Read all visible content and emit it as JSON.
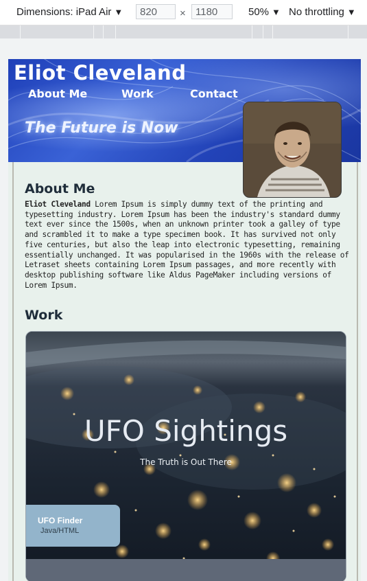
{
  "devtools": {
    "dimensions_label": "Dimensions: iPad Air",
    "width_value": "820",
    "times_symbol": "×",
    "height_value": "1180",
    "zoom": "50%",
    "throttling": "No throttling",
    "caret": "▼"
  },
  "site": {
    "title": "Eliot Cleveland",
    "nav": [
      "About Me",
      "Work",
      "Contact"
    ],
    "tagline": "The Future is Now"
  },
  "about": {
    "heading": "About Me",
    "name": "Eliot Cleveland",
    "body": " Lorem Ipsum is simply dummy text of the printing and typesetting industry. Lorem Ipsum has been the industry's standard dummy text ever since the 1500s, when an unknown printer took a galley of type and scrambled it to make a type specimen book. It has survived not only five centuries, but also the leap into electronic typesetting, remaining essentially unchanged. It was popularised in the 1960s with the release of Letraset sheets containing Lorem Ipsum passages, and more recently with desktop publishing software like Aldus PageMaker including versions of Lorem Ipsum."
  },
  "work": {
    "heading": "Work",
    "project_title": "UFO Sightings",
    "project_subtitle": "The Truth is Out There",
    "card_name": "UFO Finder",
    "card_tech": "Java/HTML"
  }
}
